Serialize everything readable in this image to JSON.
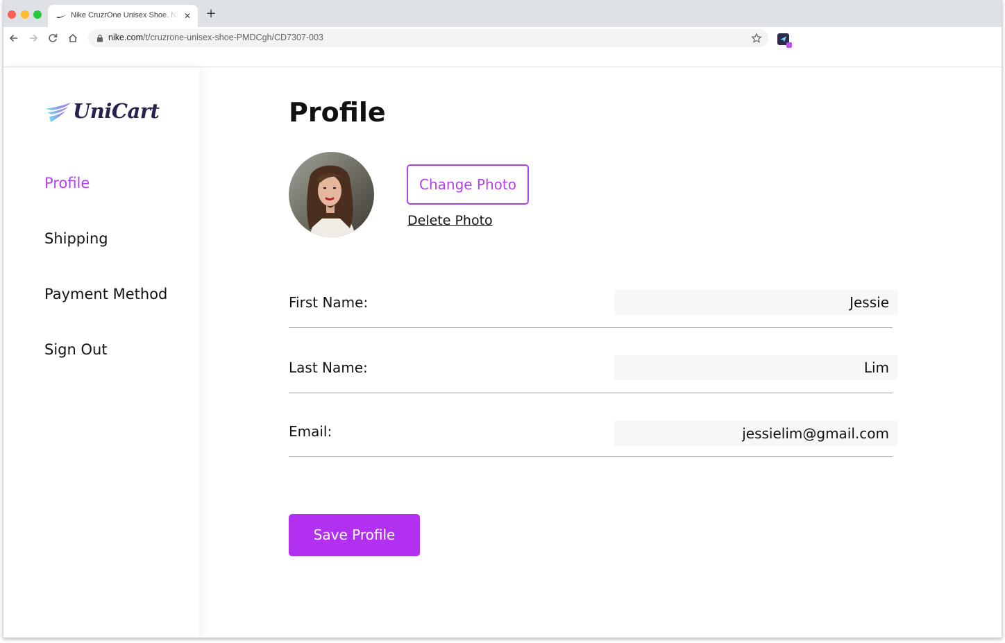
{
  "browser": {
    "tab_title": "Nike CruzrOne Unisex Shoe. Nike.com",
    "tab_close_glyph": "✕",
    "new_tab_glyph": "+",
    "url_host": "nike.com",
    "url_path": "/t/cruzrone-unisex-shoe-PMDCgh/CD7307-003",
    "icons": [
      "back-icon",
      "forward-icon",
      "reload-icon",
      "home-icon",
      "lock-icon",
      "bookmark-star-icon",
      "extension-icon"
    ]
  },
  "sidebar": {
    "logo_text": "UniCart",
    "items": [
      {
        "label": "Profile",
        "active": true
      },
      {
        "label": "Shipping",
        "active": false
      },
      {
        "label": "Payment Method",
        "active": false
      },
      {
        "label": "Sign Out",
        "active": false
      }
    ]
  },
  "main": {
    "title": "Profile",
    "change_photo_label": "Change Photo",
    "delete_photo_label": "Delete Photo",
    "fields": [
      {
        "label": "First Name:",
        "value": "Jessie"
      },
      {
        "label": "Last Name:",
        "value": "Lim"
      },
      {
        "label": "Email:",
        "value": "jessielim@gmail.com"
      }
    ],
    "save_label": "Save Profile"
  },
  "colors": {
    "accent": "#b23fec",
    "button_fill": "#b230f0",
    "text": "#111111",
    "logo_text": "#26214f",
    "input_bg": "#f7f7f7"
  }
}
